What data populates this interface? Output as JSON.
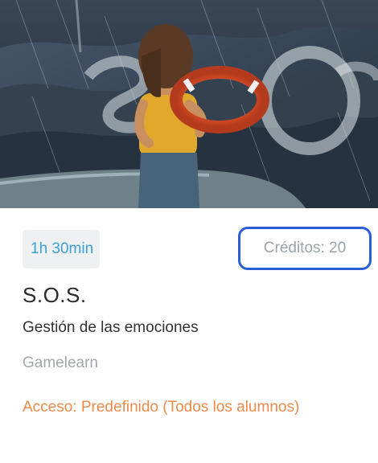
{
  "course": {
    "duration": "1h 30min",
    "credits": "Créditos: 20",
    "title": "S.O.S.",
    "subtitle": "Gestión de las emociones",
    "provider": "Gamelearn",
    "access": "Acceso: Predefinido (Todos los alumnos)"
  },
  "colors": {
    "duration_text": "#3ea0d6",
    "credits_border": "#2a5ed8",
    "access_text": "#ee8a4a",
    "provider_text": "#a0a7ae"
  }
}
